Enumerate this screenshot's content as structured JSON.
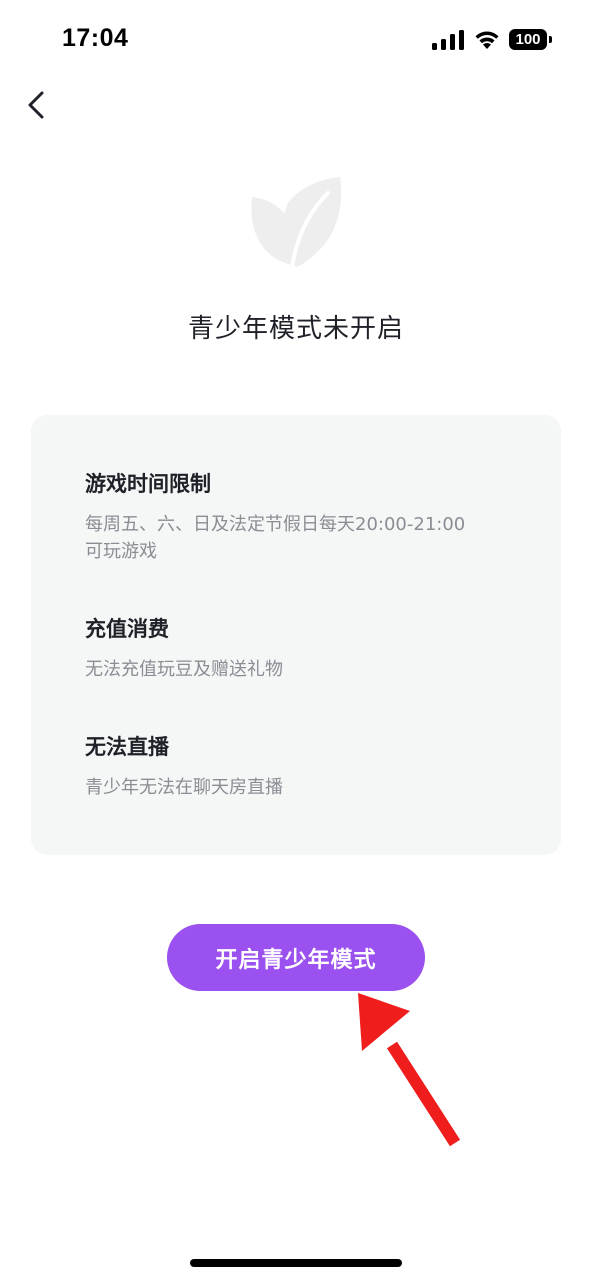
{
  "status_bar": {
    "time": "17:04",
    "battery": "100",
    "icons": [
      "signal-icon",
      "wifi-icon",
      "battery-icon"
    ]
  },
  "nav": {
    "back_icon": "chevron-left-icon"
  },
  "illustration": {
    "icon": "leaf-icon"
  },
  "page": {
    "title": "青少年模式未开启"
  },
  "info": {
    "sections": [
      {
        "title": "游戏时间限制",
        "desc_line1": "每周五、六、日及法定节假日每天20:00-21:00",
        "desc_line2": "可玩游戏"
      },
      {
        "title": "充值消费",
        "desc_line1": "无法充值玩豆及赠送礼物"
      },
      {
        "title": "无法直播",
        "desc_line1": "青少年无法在聊天房直播"
      }
    ]
  },
  "actions": {
    "enable_label": "开启青少年模式"
  },
  "colors": {
    "accent": "#9b51ef",
    "card_bg": "#f5f6f6",
    "annotation_arrow": "#f01d1d",
    "secondary_text": "#8b8d94"
  }
}
